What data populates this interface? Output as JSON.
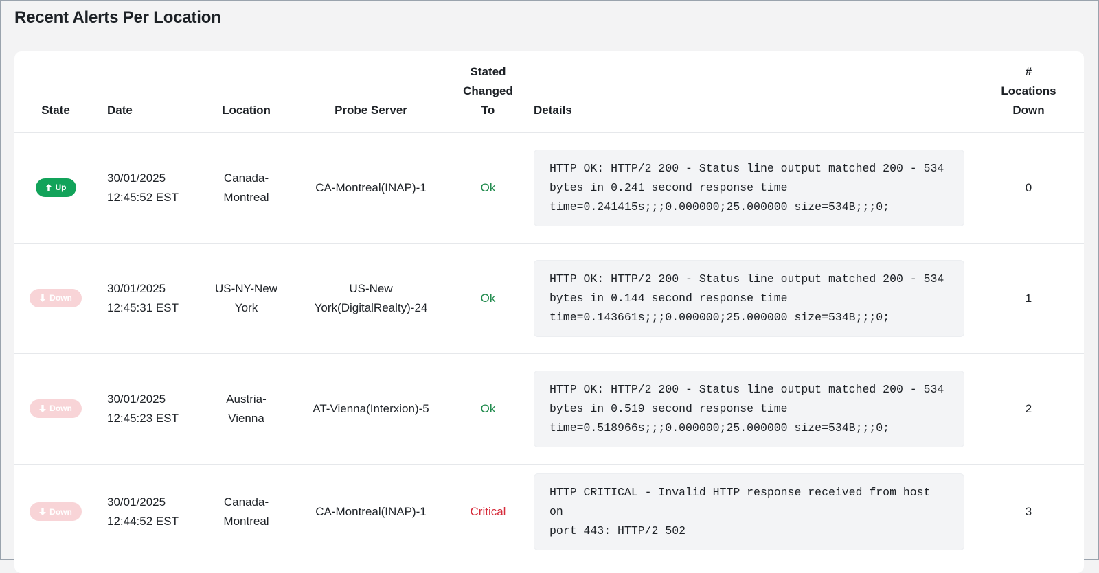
{
  "page": {
    "title": "Recent Alerts Per Location"
  },
  "table": {
    "headers": {
      "state": "State",
      "date": "Date",
      "location": "Location",
      "probe_server": "Probe Server",
      "state_changed_to": [
        "Stated",
        "Changed",
        "To"
      ],
      "details": "Details",
      "locations_down": [
        "#",
        "Locations",
        "Down"
      ]
    },
    "rows": [
      {
        "state": "Up",
        "state_icon": "arrow-up-icon",
        "date_line1": "30/01/2025",
        "date_line2": "12:45:52 EST",
        "location_line1": "Canada-",
        "location_line2": "Montreal",
        "probe_line1": "CA-Montreal(INAP)-1",
        "probe_line2": "",
        "changed_to": "Ok",
        "details_lines": [
          "HTTP OK: HTTP/2 200 - Status line output matched 200 - 534",
          "bytes in 0.241 second response time",
          "time=0.241415s;;;0.000000;25.000000 size=534B;;;0;"
        ],
        "locations_down": "0"
      },
      {
        "state": "Down",
        "state_icon": "arrow-down-icon",
        "date_line1": "30/01/2025",
        "date_line2": "12:45:31 EST",
        "location_line1": "US-NY-New",
        "location_line2": "York",
        "probe_line1": "US-New",
        "probe_line2": "York(DigitalRealty)-24",
        "changed_to": "Ok",
        "details_lines": [
          "HTTP OK: HTTP/2 200 - Status line output matched 200 - 534",
          "bytes in 0.144 second response time",
          "time=0.143661s;;;0.000000;25.000000 size=534B;;;0;"
        ],
        "locations_down": "1"
      },
      {
        "state": "Down",
        "state_icon": "arrow-down-icon",
        "date_line1": "30/01/2025",
        "date_line2": "12:45:23 EST",
        "location_line1": "Austria-",
        "location_line2": "Vienna",
        "probe_line1": "AT-Vienna(Interxion)-5",
        "probe_line2": "",
        "changed_to": "Ok",
        "details_lines": [
          "HTTP OK: HTTP/2 200 - Status line output matched 200 - 534",
          "bytes in 0.519 second response time",
          "time=0.518966s;;;0.000000;25.000000 size=534B;;;0;"
        ],
        "locations_down": "2"
      },
      {
        "state": "Down",
        "state_icon": "arrow-down-icon",
        "date_line1": "30/01/2025",
        "date_line2": "12:44:52 EST",
        "location_line1": "Canada-",
        "location_line2": "Montreal",
        "probe_line1": "CA-Montreal(INAP)-1",
        "probe_line2": "",
        "changed_to": "Critical",
        "details_lines": [
          "HTTP CRITICAL - Invalid HTTP response received from host on",
          "port 443: HTTP/2 502"
        ],
        "locations_down": "3"
      }
    ]
  },
  "colors": {
    "up_badge": "#12a35a",
    "down_badge": "#f8d4d7",
    "ok_text": "#1f8a4c",
    "critical_text": "#d62b3a"
  }
}
